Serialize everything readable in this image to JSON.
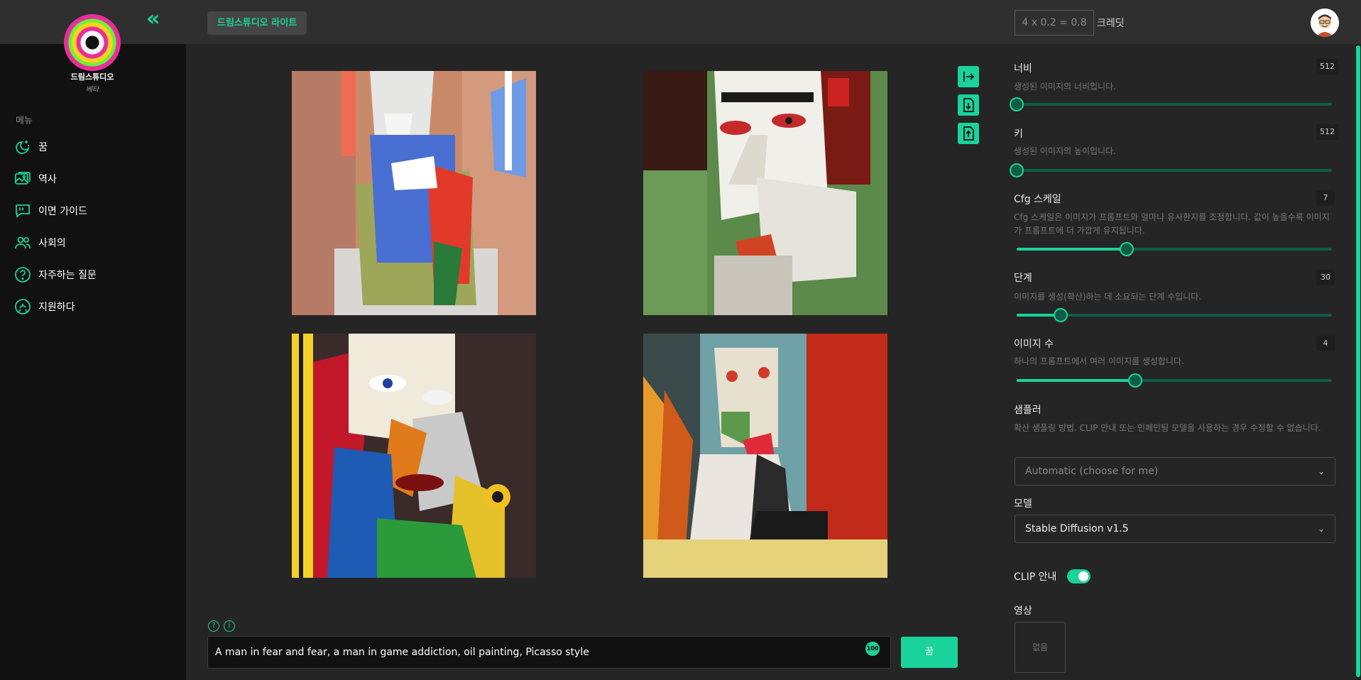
{
  "header": {
    "brand": "드림스튜디오",
    "brand_sub": "베타",
    "lite_button": "드림스튜디오 라이트",
    "credit_formula": "4 x 0.2 = 0.8",
    "credit_label": "크레딧"
  },
  "sidebar": {
    "heading": "메뉴",
    "items": [
      {
        "label": "꿈",
        "icon": "moon-stars-icon"
      },
      {
        "label": "역사",
        "icon": "images-icon"
      },
      {
        "label": "이면 가이드",
        "icon": "quote-bubble-icon"
      },
      {
        "label": "사회의",
        "icon": "users-icon"
      },
      {
        "label": "자주하는 질문",
        "icon": "question-circle-icon"
      },
      {
        "label": "지원하다",
        "icon": "support-icon"
      }
    ]
  },
  "main": {
    "images": [
      {
        "alt": "cubist seated figure"
      },
      {
        "alt": "cubist man covering mouth"
      },
      {
        "alt": "cubist fragmented face"
      },
      {
        "alt": "cubist man in jacket"
      }
    ],
    "prompt": "A man in fear and fear, a man in game addiction, oil painting, Picasso style",
    "prompt_count": "100",
    "dream_button": "꿈",
    "help_icon": "?",
    "info_icon": "i"
  },
  "settings": {
    "width": {
      "label": "너비",
      "desc": "생성된 이미지의 너비입니다.",
      "value": "512",
      "fraction": 0.0
    },
    "height": {
      "label": "키",
      "desc": "생성된 이미지의 높이입니다.",
      "value": "512",
      "fraction": 0.0
    },
    "cfg": {
      "label": "Cfg 스케일",
      "desc": "Cfg 스케일은 이미지가 프롬프트와 얼마나 유사한지를 조정합니다. 값이 높을수록 이미지가 프롬프트에 더 가깝게 유지됩니다.",
      "value": "7",
      "fraction": 0.35
    },
    "steps": {
      "label": "단계",
      "desc": "이미지를 생성(확산)하는 데 소요되는 단계 수입니다.",
      "value": "30",
      "fraction": 0.14
    },
    "count": {
      "label": "이미지 수",
      "desc": "하나의 프롬프트에서 여러 이미지를 생성합니다.",
      "value": "4",
      "fraction": 0.375
    },
    "sampler": {
      "label": "샘플러",
      "desc": "확산 샘플링 방법. CLIP 안내 또는 인페인팅 모델을 사용하는 경우 수정할 수 없습니다.",
      "value": "Automatic (choose for me)"
    },
    "model": {
      "label": "모델",
      "value": "Stable Diffusion v1.5"
    },
    "clip": {
      "label": "CLIP 안내",
      "enabled": true
    },
    "image": {
      "label": "영상",
      "placeholder": "없음"
    }
  },
  "colors": {
    "accent": "#1ad39a",
    "sidebar": "#111111",
    "panel": "#252525",
    "topbar": "#2f2f2f"
  }
}
